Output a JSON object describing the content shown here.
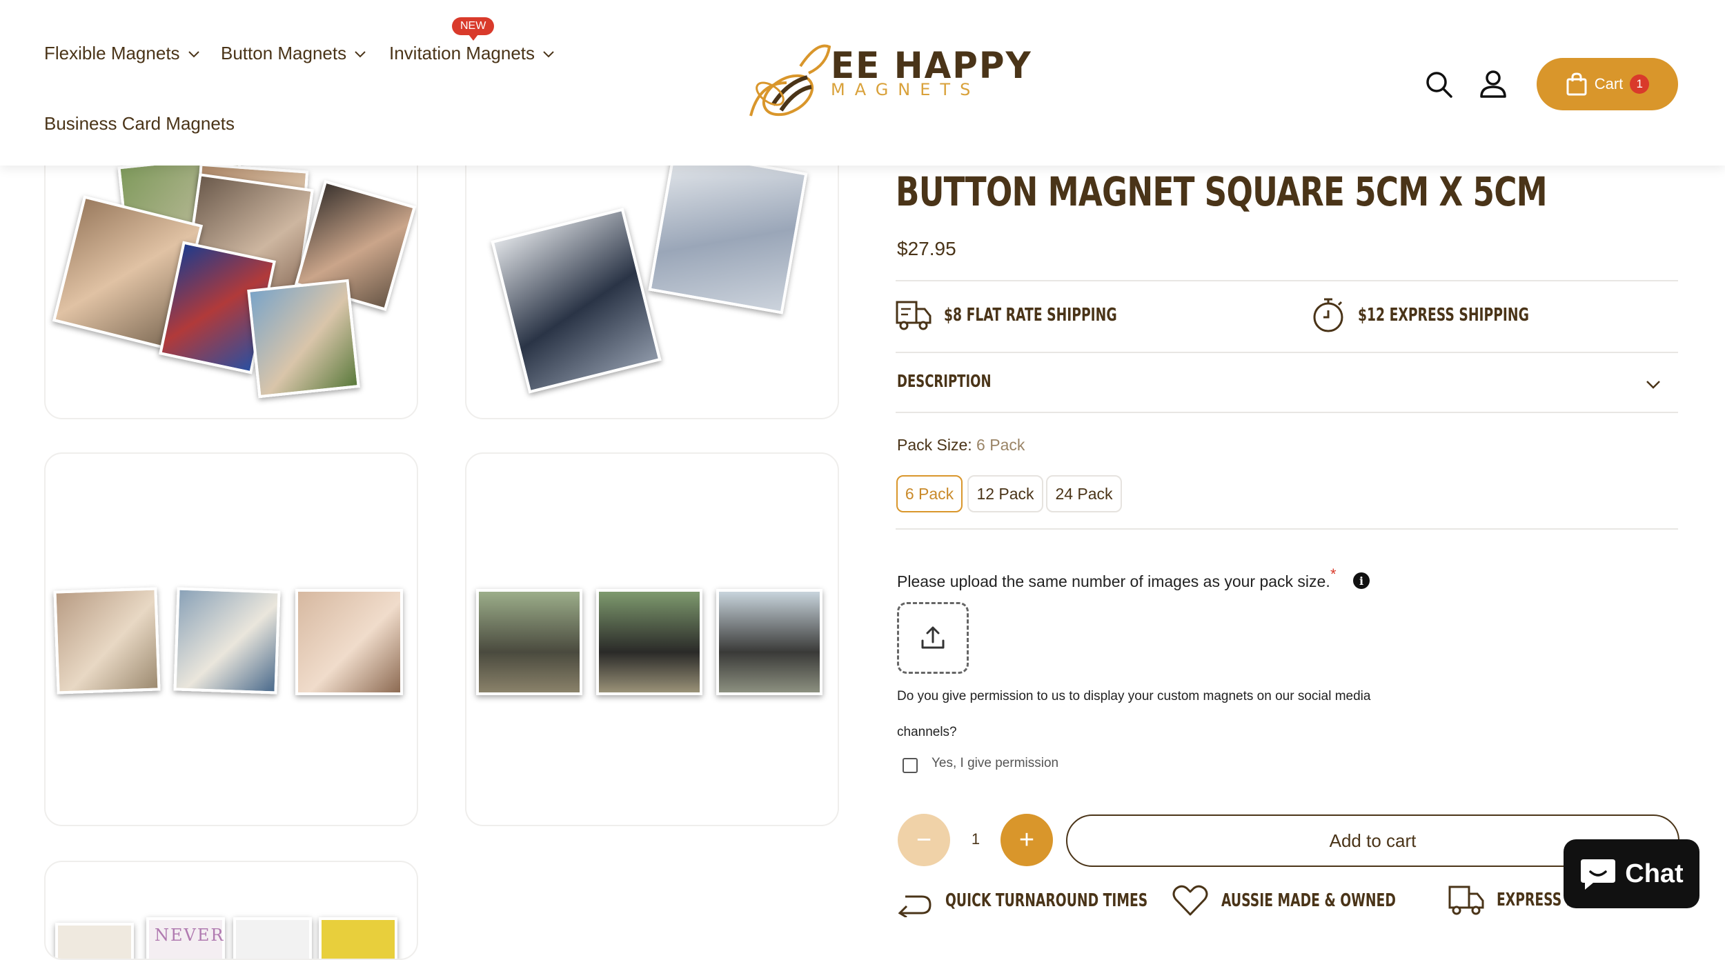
{
  "nav": {
    "items": [
      {
        "label": "Flexible Magnets"
      },
      {
        "label": "Button Magnets"
      },
      {
        "label": "Invitation Magnets"
      },
      {
        "label": "Business Card Magnets"
      }
    ],
    "new_badge": "NEW"
  },
  "logo": {
    "line1": "EE HAPPY",
    "line2": "MAGNETS"
  },
  "icons": {
    "search": "search-icon",
    "account": "user-icon",
    "cart": "shopping-bag-icon"
  },
  "cart": {
    "label": "Cart",
    "count": "1"
  },
  "product": {
    "title": "BUTTON MAGNET SQUARE 5CM X 5CM",
    "price": "$27.95",
    "shipping": [
      {
        "label": "$8 FLAT RATE SHIPPING",
        "icon": "truck-icon"
      },
      {
        "label": "$12 EXPRESS SHIPPING",
        "icon": "stopwatch-icon"
      }
    ],
    "description_label": "DESCRIPTION",
    "pack_size_label": "Pack Size:",
    "pack_size_selected": "6 Pack",
    "pack_options": [
      "6 Pack",
      "12 Pack",
      "24 Pack"
    ],
    "upload_text": "Please upload the same number of images as your pack size.",
    "required_mark": "*",
    "info_mark": "i",
    "permission_line1": "Do you give permission to us to display your custom magnets on our social media",
    "permission_line2": "channels?",
    "permission_checkbox": "Yes, I give permission",
    "permission_checked": false,
    "quantity": "1",
    "minus": "−",
    "plus": "+",
    "add_to_cart": "Add to cart"
  },
  "features": [
    {
      "label": "QUICK TURNAROUND TIMES",
      "icon": "return-arrow-icon"
    },
    {
      "label": "AUSSIE MADE & OWNED",
      "icon": "heart-icon"
    },
    {
      "label": "EXPRESS PO",
      "icon": "truck-icon"
    }
  ],
  "chat": {
    "label": "Chat"
  },
  "gallery_text": {
    "never": "NEVER"
  },
  "colors": {
    "brand_brown": "#4a3418",
    "accent_gold": "#d9962b",
    "badge_red": "#d93a2b"
  }
}
